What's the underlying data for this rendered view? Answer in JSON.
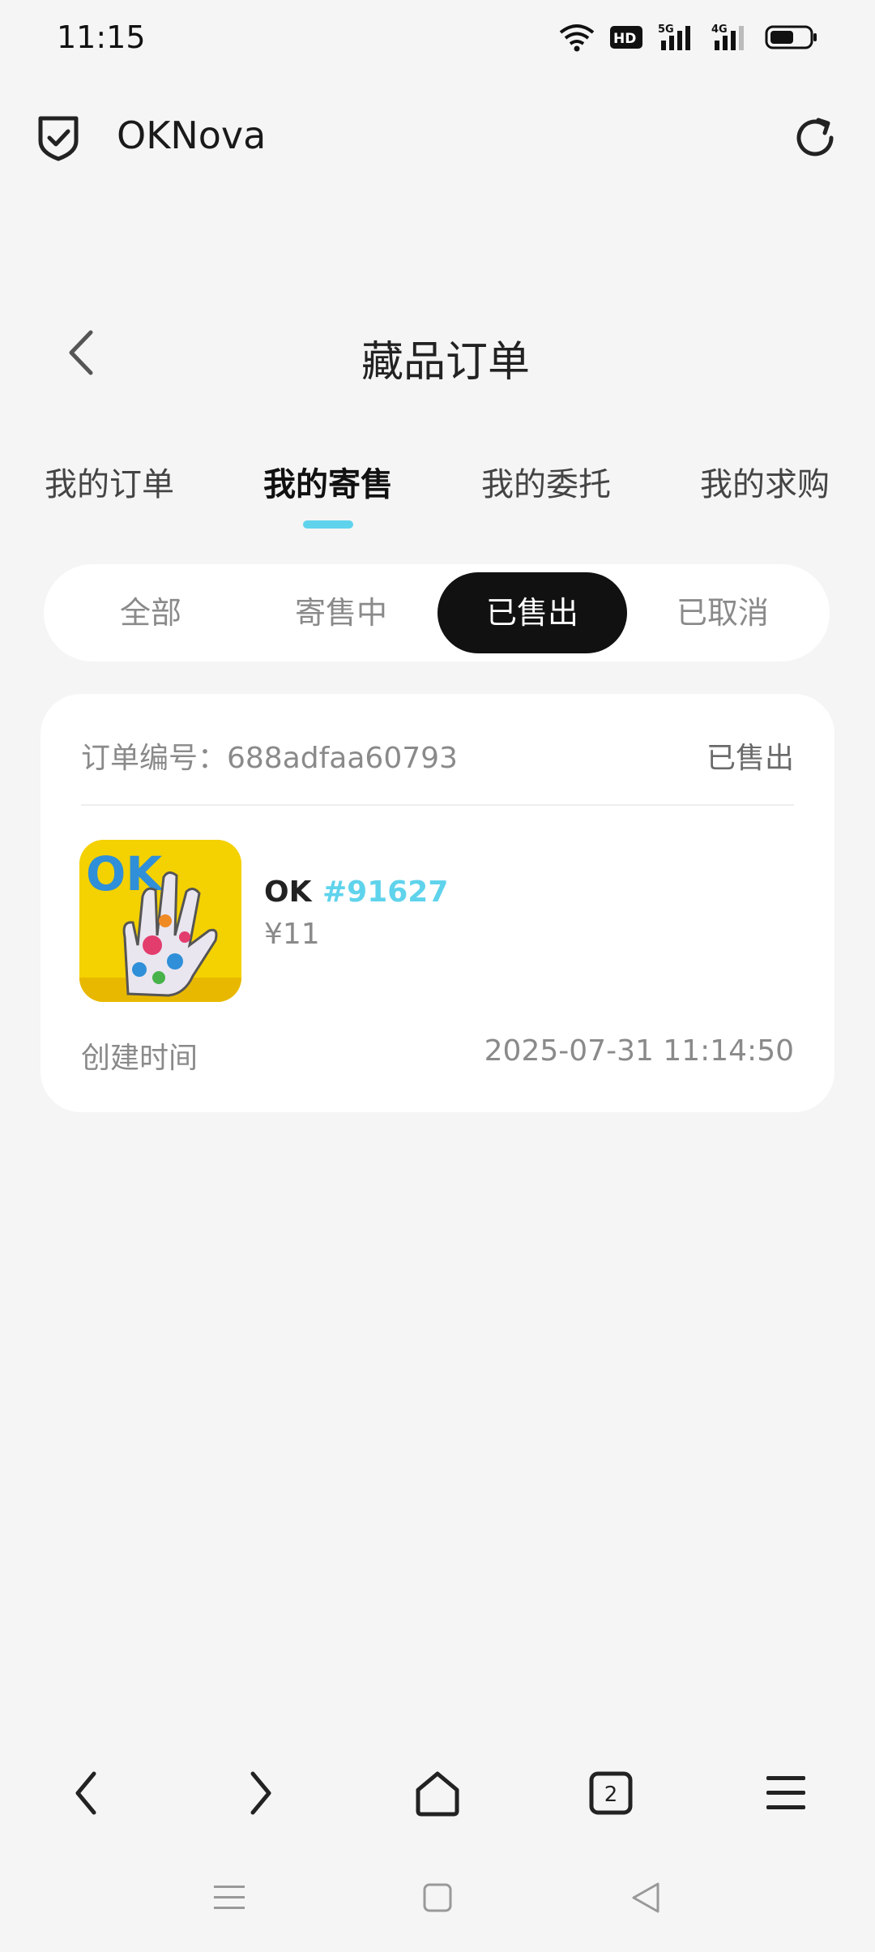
{
  "status_bar": {
    "time": "11:15",
    "hd_label": "HD",
    "net_5g": "5G",
    "net_4g": "4G"
  },
  "browser": {
    "title": "OKNova"
  },
  "page": {
    "title": "藏品订单"
  },
  "tabs": [
    {
      "label": "我的订单",
      "active": false
    },
    {
      "label": "我的寄售",
      "active": true
    },
    {
      "label": "我的委托",
      "active": false
    },
    {
      "label": "我的求购",
      "active": false
    }
  ],
  "filters": [
    {
      "label": "全部",
      "active": false
    },
    {
      "label": "寄售中",
      "active": false
    },
    {
      "label": "已售出",
      "active": true
    },
    {
      "label": "已取消",
      "active": false
    }
  ],
  "order": {
    "number_label": "订单编号：688adfaa60793",
    "status": "已售出",
    "item_name": "OK",
    "item_id": "#91627",
    "price": "¥11",
    "created_label": "创建时间",
    "created_time": "2025-07-31 11:14:50",
    "thumbnail_text": "OK"
  },
  "bottom_nav": {
    "tab_count": "2"
  },
  "colors": {
    "accent": "#5fd3ec",
    "active_segment": "#111111",
    "background": "#f5f5f5"
  },
  "icons": [
    "wifi-icon",
    "hd-icon",
    "signal-icon",
    "battery-icon",
    "shield-icon",
    "reload-icon",
    "back-icon",
    "nav-back-icon",
    "nav-forward-icon",
    "home-icon",
    "tabs-icon",
    "menu-icon",
    "sys-menu-icon",
    "sys-home-icon",
    "sys-back-icon"
  ]
}
